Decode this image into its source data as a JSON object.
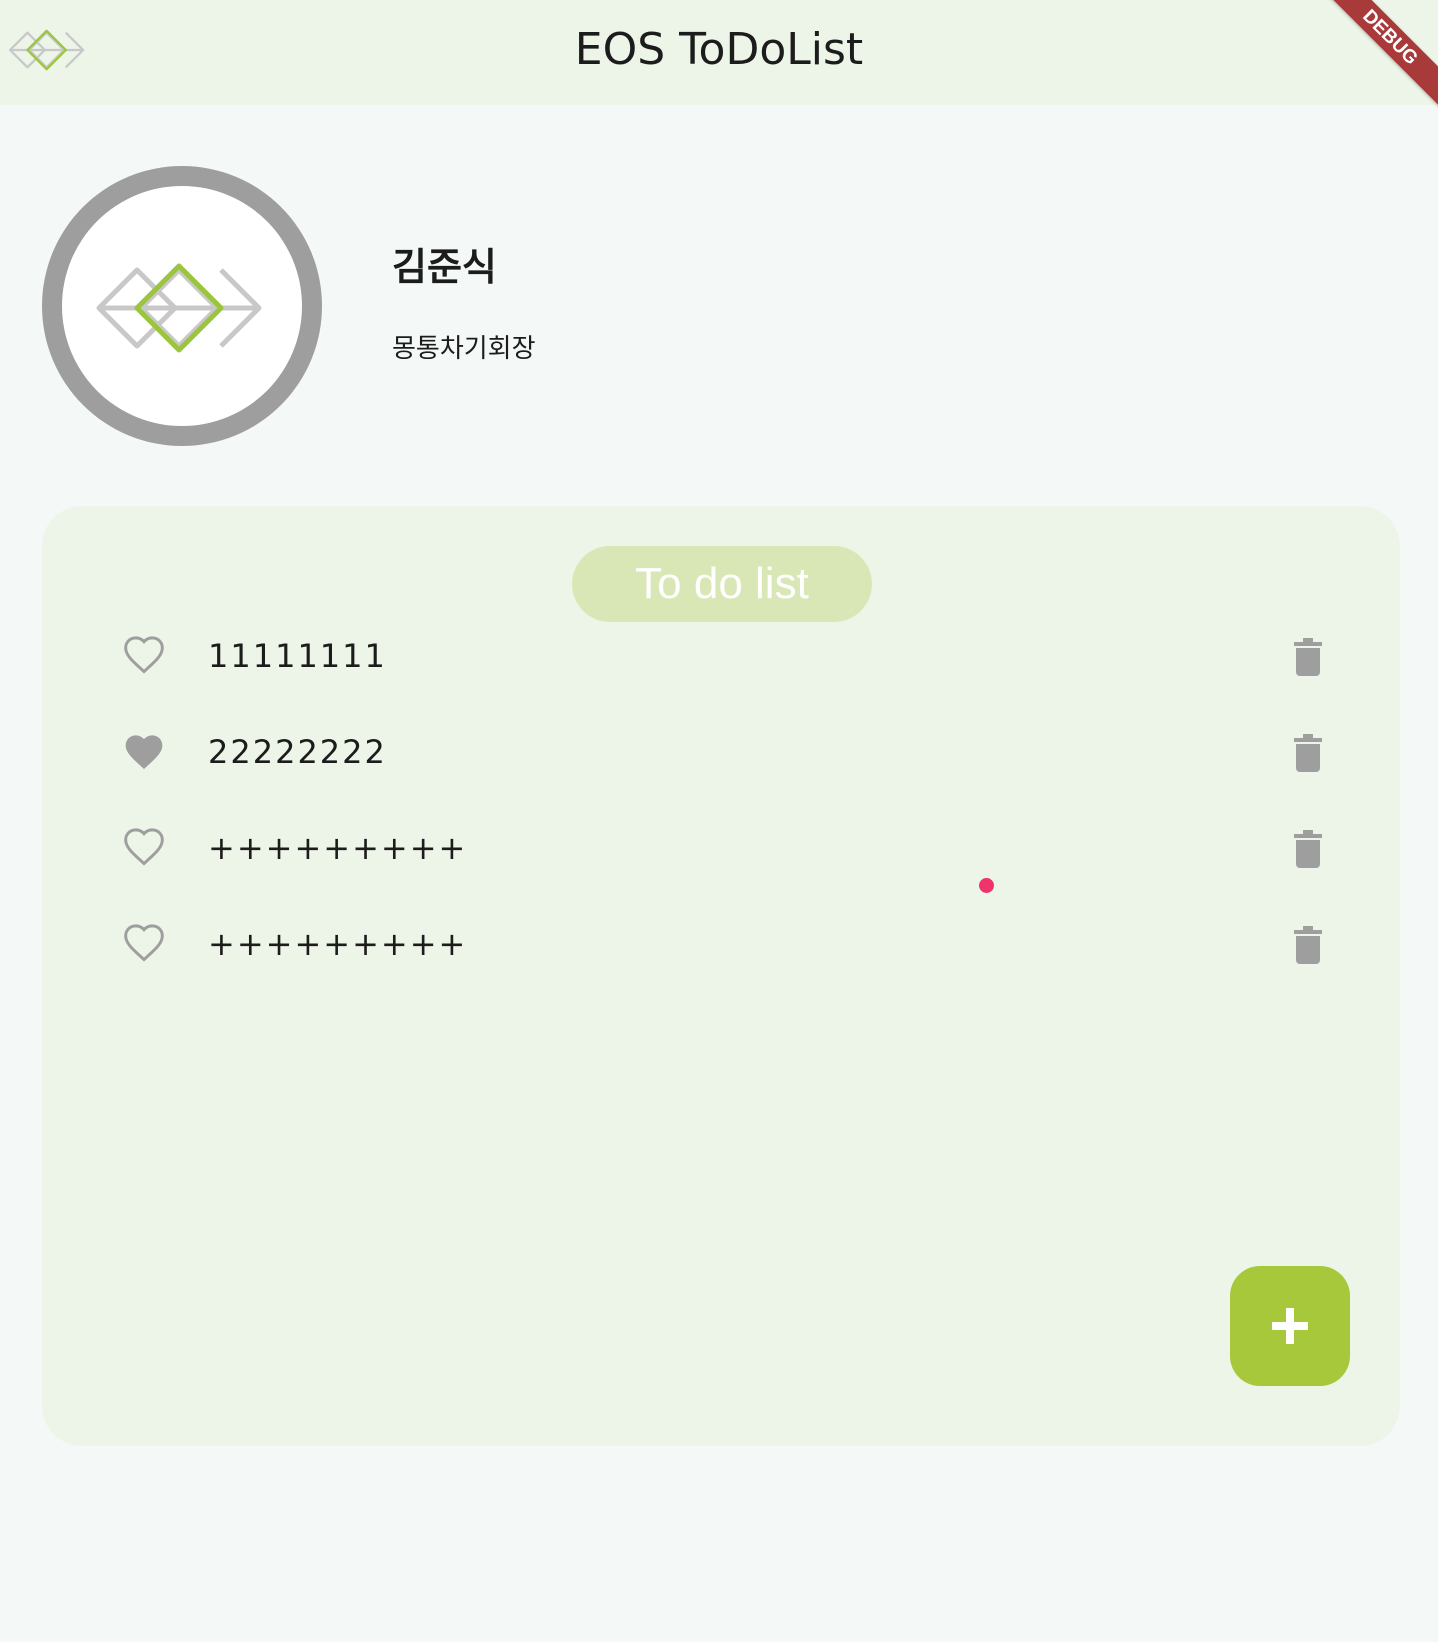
{
  "app": {
    "title": "EOS ToDoList",
    "debug_banner": "DEBUG"
  },
  "profile": {
    "name": "김준식",
    "role": "몽통차기회장"
  },
  "todo_card": {
    "title": "To do list",
    "items": [
      {
        "text": "11111111",
        "favorite": false
      },
      {
        "text": "22222222",
        "favorite": true
      },
      {
        "text": "+++++++++",
        "favorite": false
      },
      {
        "text": "+++++++++",
        "favorite": false
      }
    ]
  },
  "fab": {
    "label": "+",
    "icon": "plus-icon"
  },
  "icons": {
    "logo": "eos-logo-icon",
    "favorite_empty": "heart-outline-icon",
    "favorite_filled": "heart-filled-icon",
    "delete": "trash-icon"
  },
  "colors": {
    "appbar_bg": "#edf4e8",
    "page_bg": "#f4f9f8",
    "card_bg": "#edf4e8",
    "title_pill_bg": "#d9e7b6",
    "accent_green": "#a6c83a",
    "icon_gray": "#9e9e9e",
    "debug_red": "#a93a3a",
    "touch_indicator": "#f0336a"
  }
}
